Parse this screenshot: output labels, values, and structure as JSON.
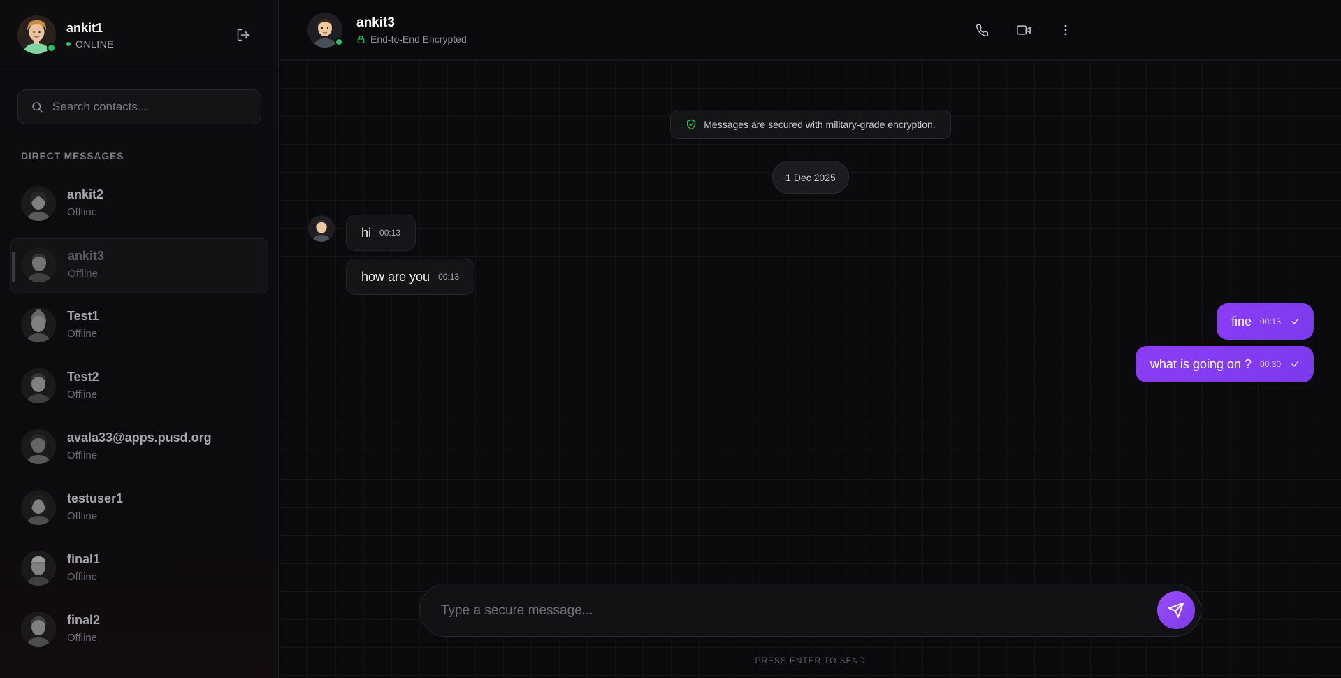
{
  "me": {
    "name": "ankit1",
    "status": "ONLINE",
    "logout_icon": "logout-icon"
  },
  "search": {
    "placeholder": "Search contacts...",
    "value": ""
  },
  "sidebar": {
    "section_label": "DIRECT MESSAGES",
    "contacts": [
      {
        "name": "ankit2",
        "status": "Offline",
        "active": false
      },
      {
        "name": "ankit3",
        "status": "Offline",
        "active": true
      },
      {
        "name": "Test1",
        "status": "Offline",
        "active": false
      },
      {
        "name": "Test2",
        "status": "Offline",
        "active": false
      },
      {
        "name": "avala33@apps.pusd.org",
        "status": "Offline",
        "active": false
      },
      {
        "name": "testuser1",
        "status": "Offline",
        "active": false
      },
      {
        "name": "final1",
        "status": "Offline",
        "active": false
      },
      {
        "name": "final2",
        "status": "Offline",
        "active": false
      }
    ]
  },
  "chat": {
    "peer_name": "ankit3",
    "peer_subtitle": "End-to-End Encrypted",
    "actions": [
      "phone-icon",
      "video-icon",
      "more-vertical-icon"
    ],
    "encryption_banner": "Messages are secured with military-grade encryption.",
    "date_separator": "1 Dec 2025",
    "messages": [
      {
        "direction": "in",
        "text": "hi",
        "time": "00:13"
      },
      {
        "direction": "in",
        "text": "how are you",
        "time": "00:13"
      },
      {
        "direction": "out",
        "text": "fine",
        "time": "00:13",
        "status": "sent"
      },
      {
        "direction": "out",
        "text": "what is going on ?",
        "time": "00:30",
        "status": "sent"
      }
    ]
  },
  "composer": {
    "placeholder": "Type a secure message...",
    "value": "",
    "hint": "PRESS ENTER TO SEND"
  },
  "colors": {
    "accent": "#7c3aed",
    "online": "#22c55e",
    "background": "#0a0a0b"
  }
}
